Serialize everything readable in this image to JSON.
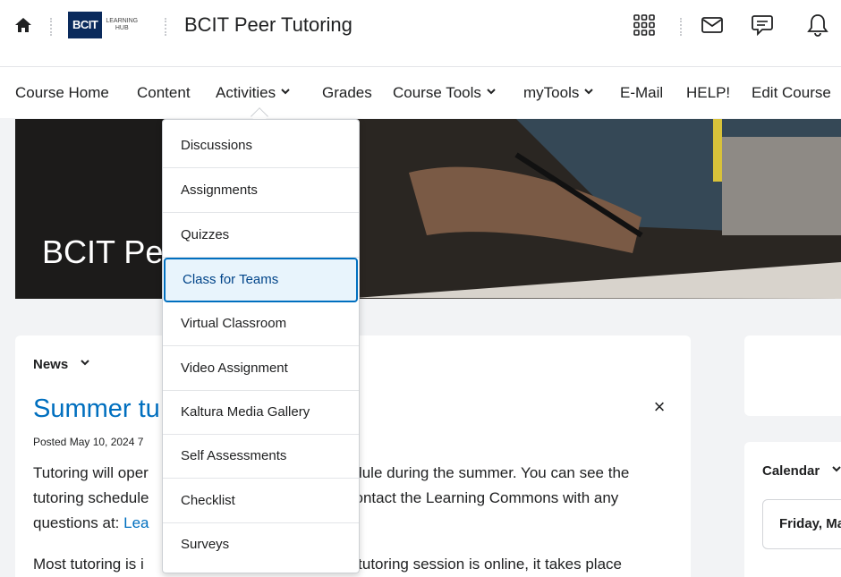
{
  "header": {
    "logo_main": "BCIT",
    "logo_sub_line1": "LEARNING",
    "logo_sub_line2": "HUB",
    "site_title": "BCIT Peer Tutoring",
    "icons": [
      "home-icon",
      "grid-apps-icon",
      "mail-icon",
      "chat-icon",
      "bell-icon"
    ]
  },
  "nav": {
    "items": [
      {
        "label": "Course Home",
        "dropdown": false
      },
      {
        "label": "Content",
        "dropdown": false
      },
      {
        "label": "Activities",
        "dropdown": true
      },
      {
        "label": "Grades",
        "dropdown": false
      },
      {
        "label": "Course Tools",
        "dropdown": true
      },
      {
        "label": "myTools",
        "dropdown": true
      },
      {
        "label": "E-Mail",
        "dropdown": false
      },
      {
        "label": "HELP!",
        "dropdown": false
      },
      {
        "label": "Edit Course",
        "dropdown": false
      }
    ]
  },
  "banner": {
    "title": "BCIT Pe"
  },
  "dropdown": {
    "items": [
      {
        "label": "Discussions"
      },
      {
        "label": "Assignments"
      },
      {
        "label": "Quizzes"
      },
      {
        "label": "Class for Teams",
        "active": true
      },
      {
        "label": "Virtual Classroom"
      },
      {
        "label": "Video Assignment"
      },
      {
        "label": "Kaltura Media Gallery"
      },
      {
        "label": "Self Assessments"
      },
      {
        "label": "Checklist"
      },
      {
        "label": "Surveys"
      }
    ]
  },
  "news": {
    "heading": "News",
    "title": "Summer tu",
    "close": "×",
    "posted": "Posted May 10, 2024 7",
    "line1_a": "Tutoring will oper",
    "line1_b": "edule during the summer. You can see the",
    "line2_a": "tutoring schedule",
    "line2_b": "ontact the Learning Commons with any",
    "line3_a": "questions at: ",
    "line3_link": "Lea",
    "line4_a": "Most tutoring is i",
    "line4_b": "r tutoring session is online, it takes place"
  },
  "calendar": {
    "label": "Calendar",
    "day": "Friday, Ma"
  },
  "colors": {
    "accent": "#006fbf",
    "logo_bg": "#0a2a5c",
    "active_bg": "#e8f4fc"
  }
}
